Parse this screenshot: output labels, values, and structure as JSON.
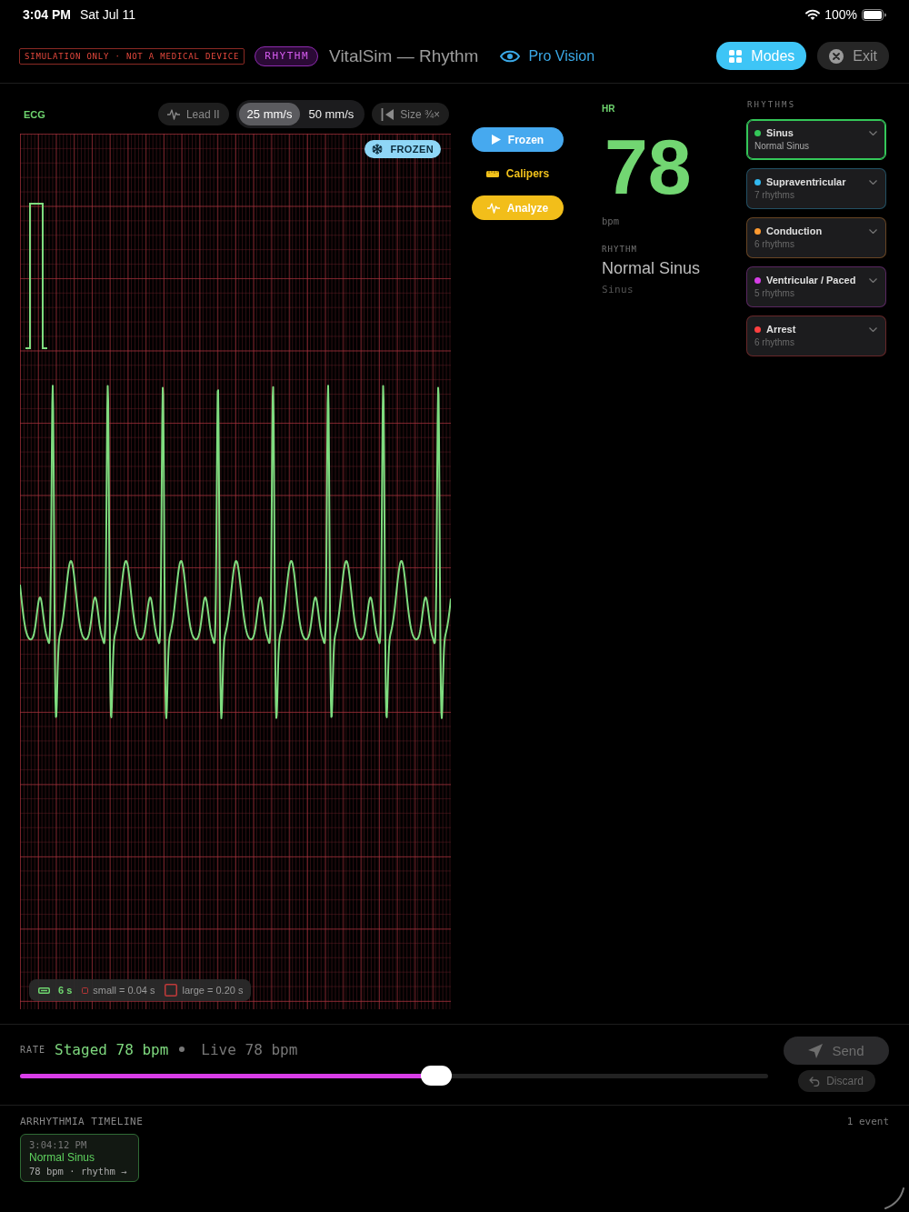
{
  "status_bar": {
    "time": "3:04 PM",
    "date": "Sat Jul 11",
    "battery": "100%"
  },
  "header": {
    "disclaimer": "SIMULATION ONLY · NOT A MEDICAL DEVICE",
    "mode_badge": "RHYTHM",
    "title": "VitalSim — Rhythm",
    "pro_vision": "Pro Vision",
    "buttons": [
      {
        "label": "Modes",
        "kind": "primary"
      },
      {
        "label": "Exit",
        "kind": "close"
      }
    ]
  },
  "ecg": {
    "label": "ECG",
    "lead": "Lead II",
    "speeds": [
      {
        "label": "25 mm/s",
        "selected": true
      },
      {
        "label": "50 mm/s",
        "selected": false
      }
    ],
    "size": "Size ¾×",
    "frozen_badge": "FROZEN",
    "legend": {
      "duration": "6 s",
      "small": "small = 0.04 s",
      "large": "large = 0.20 s"
    }
  },
  "actions": [
    {
      "label": "Frozen",
      "kind": "toggle"
    },
    {
      "label": "Calipers",
      "kind": "tool"
    },
    {
      "label": "Analyze",
      "kind": "action"
    }
  ],
  "vitals": {
    "hr_label": "HR",
    "hr": "78",
    "unit": "bpm",
    "rhythm_label": "RHYTHM",
    "rhythm": "Normal Sinus",
    "family": "Sinus"
  },
  "rhythms": {
    "title": "RHYTHMS",
    "items": [
      {
        "name": "Sinus",
        "detail": "Normal Sinus",
        "color": "#34c759",
        "selected": true
      },
      {
        "name": "Supraventricular",
        "detail": "7 rhythms",
        "color": "#32b9f0",
        "selected": false
      },
      {
        "name": "Conduction",
        "detail": "6 rhythms",
        "color": "#ff9a30",
        "selected": false
      },
      {
        "name": "Ventricular / Paced",
        "detail": "5 rhythms",
        "color": "#d63ee6",
        "selected": false
      },
      {
        "name": "Arrest",
        "detail": "6 rhythms",
        "color": "#ff4040",
        "selected": false
      }
    ]
  },
  "rate": {
    "label": "RATE",
    "staged": "Staged 78 bpm",
    "live": "Live 78 bpm",
    "level": 0.556,
    "buttons": [
      {
        "label": "Send",
        "kind": "send",
        "disabled": true
      },
      {
        "label": "Discard",
        "kind": "undo",
        "disabled": true
      }
    ]
  },
  "timeline": {
    "title": "ARRHYTHMIA TIMELINE",
    "count": "1 event",
    "events": [
      {
        "time": "3:04:12 PM",
        "rhythm": "Normal Sinus",
        "detail": "78 bpm · rhythm →"
      }
    ]
  }
}
